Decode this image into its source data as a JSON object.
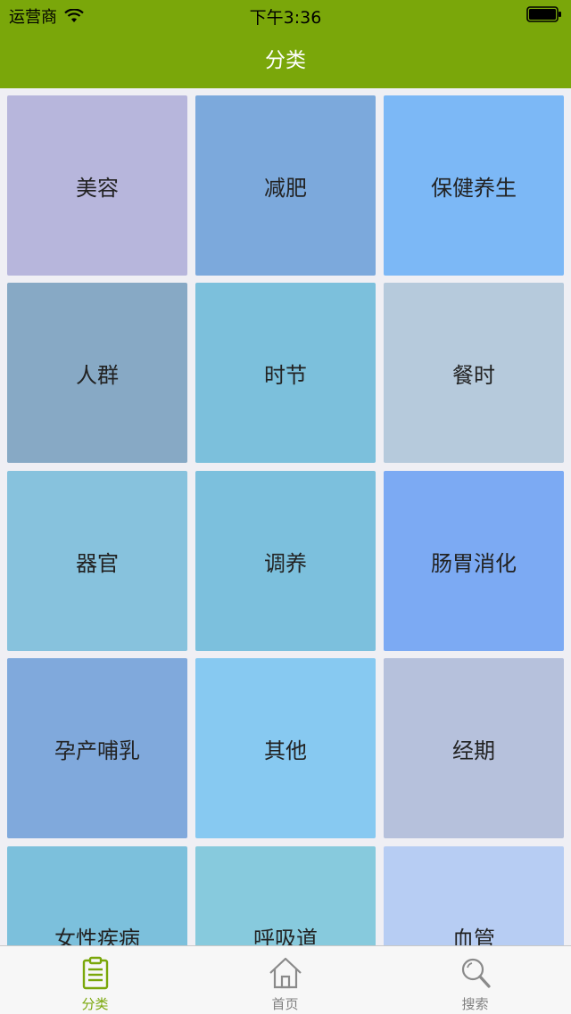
{
  "status_bar": {
    "carrier": "运营商",
    "time": "下午3:36",
    "wifi_icon": "wifi-icon",
    "battery_icon": "battery-icon"
  },
  "nav": {
    "title": "分类",
    "background_color": "#7aa70a"
  },
  "categories": [
    {
      "label": "美容",
      "color": "#b7b6dc"
    },
    {
      "label": "减肥",
      "color": "#7ca9dc"
    },
    {
      "label": "保健养生",
      "color": "#7cb8f6"
    },
    {
      "label": "人群",
      "color": "#87a9c5"
    },
    {
      "label": "时节",
      "color": "#7cc0dc"
    },
    {
      "label": "餐时",
      "color": "#b6cadc"
    },
    {
      "label": "器官",
      "color": "#87c2dd"
    },
    {
      "label": "调养",
      "color": "#7cc0dd"
    },
    {
      "label": "肠胃消化",
      "color": "#7caaf3"
    },
    {
      "label": "孕产哺乳",
      "color": "#80a9dc"
    },
    {
      "label": "其他",
      "color": "#87c9f1"
    },
    {
      "label": "经期",
      "color": "#b6c1dc"
    },
    {
      "label": "女性疾病",
      "color": "#7cc0dc"
    },
    {
      "label": "呼吸道",
      "color": "#87cadd"
    },
    {
      "label": "血管",
      "color": "#b7cdf3"
    }
  ],
  "tabbar": {
    "tabs": [
      {
        "label": "分类",
        "icon": "clipboard-list-icon",
        "active": true
      },
      {
        "label": "首页",
        "icon": "home-icon",
        "active": false
      },
      {
        "label": "搜索",
        "icon": "search-icon",
        "active": false
      }
    ],
    "active_color": "#7aa70a",
    "inactive_color": "#808080"
  }
}
